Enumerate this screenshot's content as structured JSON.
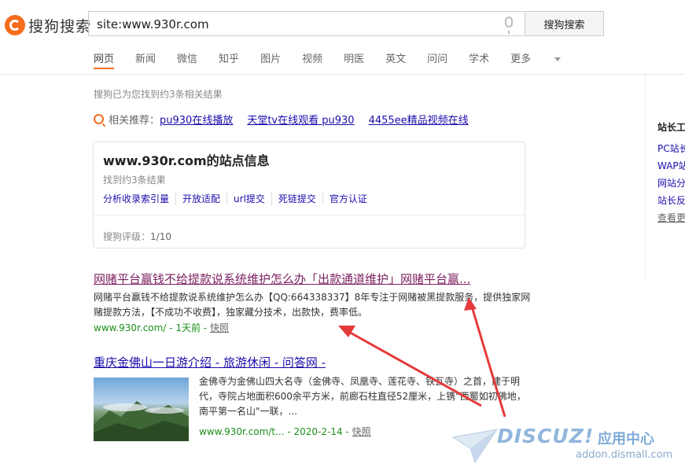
{
  "header": {
    "logo_text": "搜狗搜索",
    "search_value": "site:www.930r.com",
    "search_button": "搜狗搜索"
  },
  "nav": {
    "tabs": [
      "网页",
      "新闻",
      "微信",
      "知乎",
      "图片",
      "视频",
      "明医",
      "英文",
      "问问",
      "学术",
      "更多"
    ]
  },
  "result_count": "搜狗已为您找到约3条相关结果",
  "related": {
    "label": "相关推荐：",
    "items": [
      "pu930在线播放",
      "天堂tv在线观看 pu930",
      "4455ee精品视频在线"
    ]
  },
  "site_card": {
    "title": "www.930r.com的站点信息",
    "found": "找到约3条结果",
    "links": [
      "分析收录索引量",
      "开放适配",
      "url提交",
      "死链提交",
      "官方认证"
    ],
    "rating_label": "搜狗评级：",
    "rating_value": "1/10"
  },
  "results": [
    {
      "title": "网赌平台赢钱不给提款说系统维护怎么办「出款通道维护」网赌平台赢...",
      "desc": "网赌平台赢钱不给提款说系统维护怎么办【QQ:664338337】8年专注于网赌被黑提款服务，提供独家网赌提款方法，【不成功不收费】，独家藏分技术，出款快，费率低。",
      "url": "www.930r.com/",
      "time": " - 1天前 - ",
      "snapshot": "快照"
    },
    {
      "title": "重庆金佛山一日游介绍 - 旅游休闲 - 问答网 -",
      "desc": "金佛寺为金佛山四大名寺（金佛寺、凤凰寺、莲花寺、铁瓦寺）之首，建于明代，寺院占地面积600余平方米，前廊石柱直径52厘米，上镌\"西蜀如初佛地，南平第一名山\"一联，...",
      "url": "www.930r.com/t...",
      "time": " - 2020-2-14 - ",
      "snapshot": "快照"
    }
  ],
  "sidebar": {
    "head": "站长工",
    "items": [
      "PC站长",
      "WAP站",
      "网站分",
      "站长反"
    ],
    "more": "查看更"
  },
  "watermark": {
    "main": "DISCUZ!",
    "cn": "应用中心",
    "sub": "addon.dismall.com"
  },
  "colors": {
    "brand": "#f56c1d",
    "link": "#1a0dab",
    "url": "#1c8f1c"
  }
}
